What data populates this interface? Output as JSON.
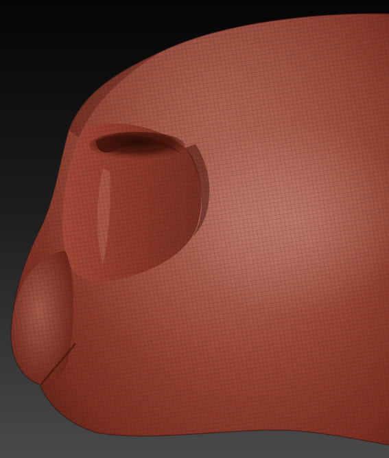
{
  "scene": {
    "subject": "sculpted-nose-mesh",
    "material_color": "#8e3a2c",
    "highlight_color": "#c27a6c",
    "shadow_color": "#3a130d",
    "background_top": "#050505",
    "background_bottom": "#4a4a4a",
    "wireframe_visible": true
  }
}
